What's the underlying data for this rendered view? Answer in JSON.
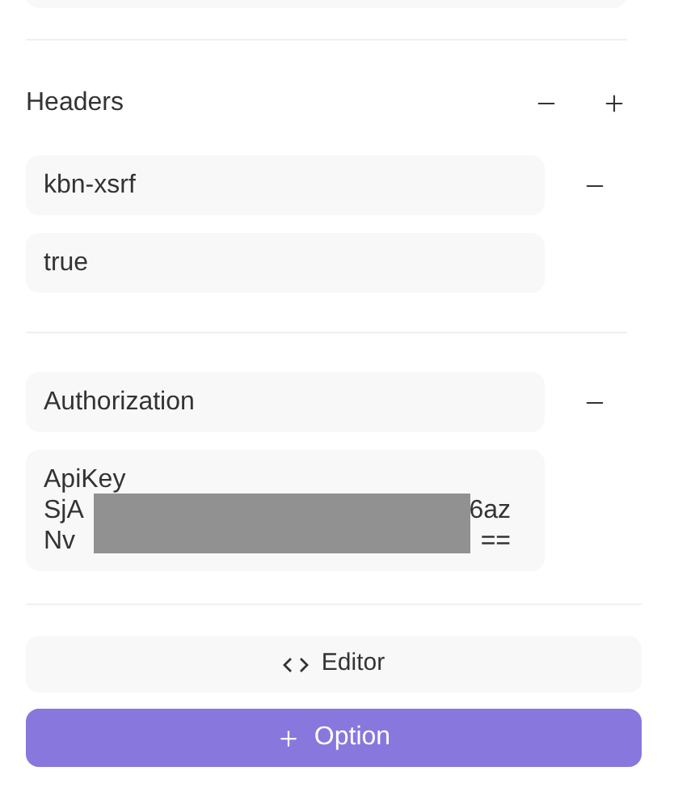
{
  "section": {
    "title": "Headers"
  },
  "headers": [
    {
      "name": "kbn-xsrf",
      "value": {
        "lines": [
          {
            "left": "true"
          }
        ],
        "redacted": false
      }
    },
    {
      "name": "Authorization",
      "value": {
        "lines": [
          {
            "left": "ApiKey"
          },
          {
            "left": "SjA",
            "right": "6az"
          },
          {
            "left": "Nv",
            "right": "=="
          }
        ],
        "redacted": true
      }
    }
  ],
  "buttons": [
    {
      "kind": "secondary",
      "label": "Editor"
    },
    {
      "kind": "primary",
      "label": "Option"
    }
  ]
}
